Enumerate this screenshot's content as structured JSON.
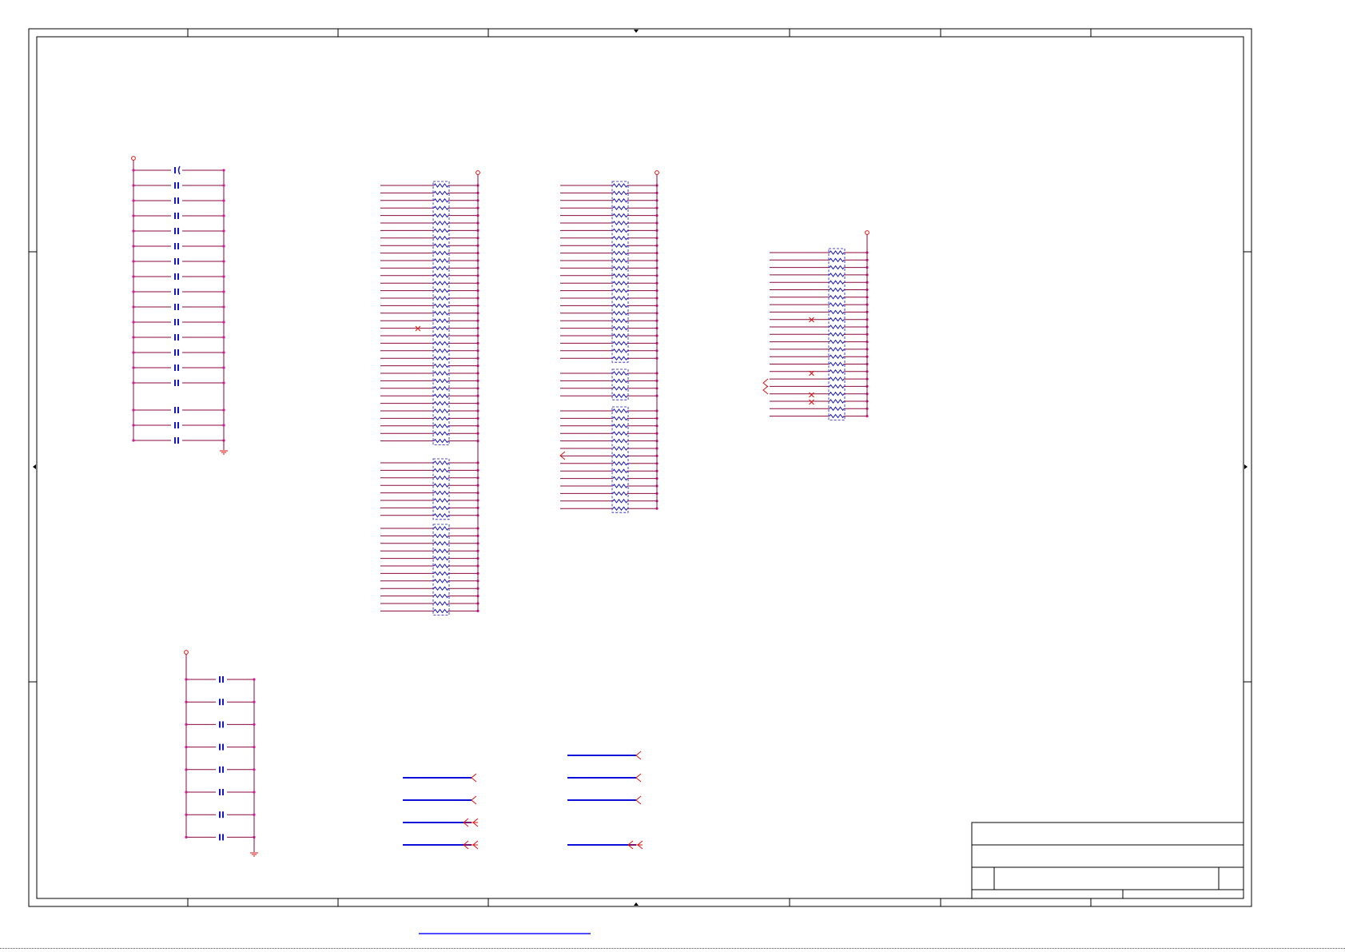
{
  "colors": {
    "frame": "#000000",
    "wire": "#8a0a3c",
    "component": "#1515c8",
    "power": "#e01010",
    "junction": "#d4149a",
    "bus": "#0b10d8"
  },
  "sheet": {
    "title_block_text": "",
    "footer_link_text": ""
  },
  "symbols": {
    "power_flag_icon": "power-flag-icon",
    "ground_icon": "ground-icon",
    "no_connect_icon": "no-connect-icon",
    "offpage_connector_icon": "offpage-connector-icon",
    "capacitor_icon": "capacitor-icon",
    "resistor_icon": "resistor-icon"
  },
  "blocks": {
    "decoupling_caps_top": {
      "capacitor_count": 18,
      "polarized_count": 1
    },
    "decoupling_caps_bottom": {
      "capacitor_count": 8
    },
    "pullup_array_1": {
      "resistor_count": 55
    },
    "pullup_array_2": {
      "resistor_count": 42
    },
    "pullup_array_3": {
      "resistor_count": 24
    },
    "bus_signals_left": {
      "count": 4
    },
    "bus_signals_right": {
      "count": 4
    }
  }
}
